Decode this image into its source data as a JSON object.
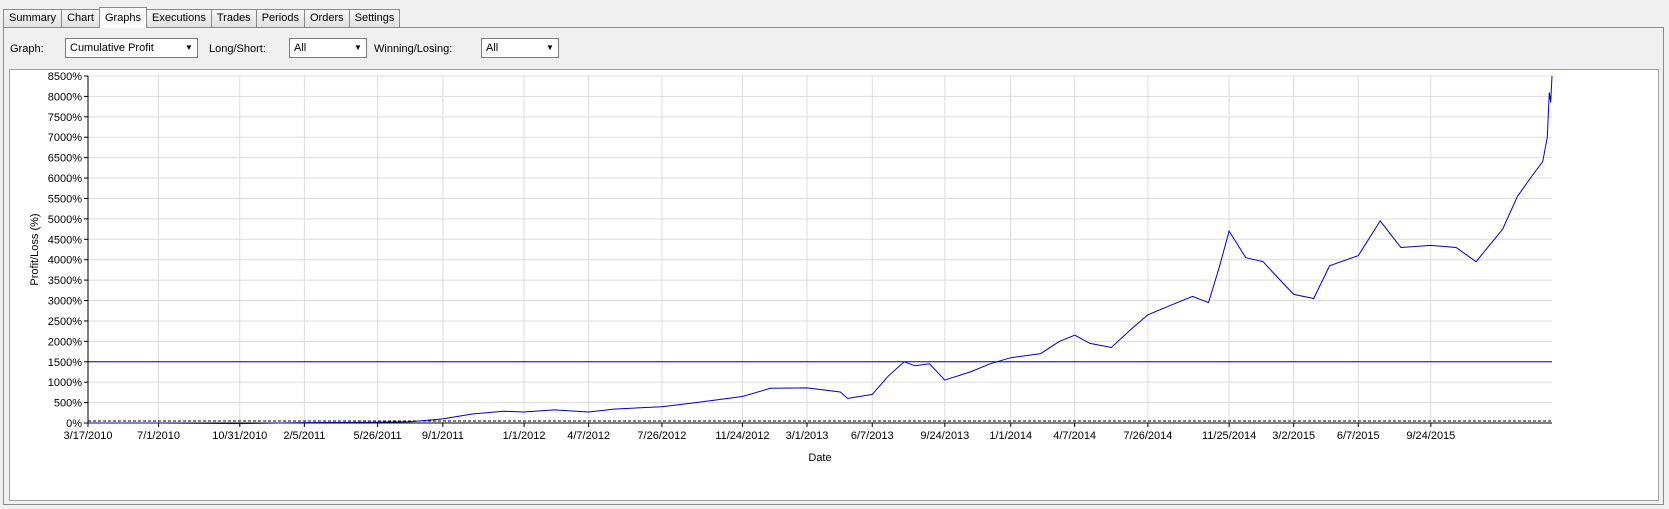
{
  "tabs": [
    {
      "label": "Summary",
      "active": false
    },
    {
      "label": "Chart",
      "active": false
    },
    {
      "label": "Graphs",
      "active": true
    },
    {
      "label": "Executions",
      "active": false
    },
    {
      "label": "Trades",
      "active": false
    },
    {
      "label": "Periods",
      "active": false
    },
    {
      "label": "Orders",
      "active": false
    },
    {
      "label": "Settings",
      "active": false
    }
  ],
  "filters": {
    "graph": {
      "label": "Graph:",
      "value": "Cumulative Profit"
    },
    "long_short": {
      "label": "Long/Short:",
      "value": "All"
    },
    "winning_losing": {
      "label": "Winning/Losing:",
      "value": "All"
    }
  },
  "colors": {
    "line": "#0000cc",
    "grid": "#dcdcdc",
    "text": "#000000"
  },
  "chart_data": {
    "type": "line",
    "xlabel": "Date",
    "ylabel": "Profit/Loss (%)",
    "ylim": [
      0,
      8500
    ],
    "yticks": [
      "0%",
      "500%",
      "1000%",
      "1500%",
      "2000%",
      "2500%",
      "3000%",
      "3500%",
      "4000%",
      "4500%",
      "5000%",
      "5500%",
      "6000%",
      "6500%",
      "7000%",
      "7500%",
      "8000%",
      "8500%"
    ],
    "xticks": [
      "3/17/2010",
      "7/1/2010",
      "10/31/2010",
      "2/5/2011",
      "5/26/2011",
      "9/1/2011",
      "1/1/2012",
      "4/7/2012",
      "7/26/2012",
      "11/24/2012",
      "3/1/2013",
      "6/7/2013",
      "9/24/2013",
      "1/1/2014",
      "4/7/2014",
      "7/26/2014",
      "11/25/2014",
      "3/2/2015",
      "6/7/2015",
      "9/24/2015"
    ],
    "x_range": [
      "3/17/2010",
      "3/24/2016"
    ],
    "reference_line": 1500,
    "grid": true,
    "series": [
      {
        "points": [
          [
            "3/17/2010",
            0
          ],
          [
            "7/1/2010",
            0
          ],
          [
            "10/31/2010",
            -15
          ],
          [
            "2/5/2011",
            10
          ],
          [
            "5/26/2011",
            20
          ],
          [
            "7/15/2011",
            30
          ],
          [
            "9/1/2011",
            100
          ],
          [
            "10/15/2011",
            220
          ],
          [
            "12/1/2011",
            290
          ],
          [
            "1/1/2012",
            270
          ],
          [
            "2/15/2012",
            320
          ],
          [
            "4/7/2012",
            270
          ],
          [
            "5/15/2012",
            340
          ],
          [
            "7/26/2012",
            400
          ],
          [
            "9/15/2012",
            500
          ],
          [
            "11/24/2012",
            650
          ],
          [
            "1/5/2013",
            850
          ],
          [
            "3/1/2013",
            860
          ],
          [
            "4/20/2013",
            760
          ],
          [
            "5/1/2013",
            600
          ],
          [
            "6/7/2013",
            700
          ],
          [
            "7/1/2013",
            1150
          ],
          [
            "7/25/2013",
            1500
          ],
          [
            "8/10/2013",
            1400
          ],
          [
            "9/1/2013",
            1450
          ],
          [
            "9/24/2013",
            1050
          ],
          [
            "11/1/2013",
            1250
          ],
          [
            "12/1/2013",
            1450
          ],
          [
            "1/1/2014",
            1600
          ],
          [
            "2/15/2014",
            1700
          ],
          [
            "3/15/2014",
            2000
          ],
          [
            "4/7/2014",
            2150
          ],
          [
            "4/30/2014",
            1950
          ],
          [
            "6/1/2014",
            1850
          ],
          [
            "7/1/2014",
            2300
          ],
          [
            "7/26/2014",
            2650
          ],
          [
            "9/1/2014",
            2900
          ],
          [
            "10/1/2014",
            3100
          ],
          [
            "10/25/2014",
            2950
          ],
          [
            "11/10/2014",
            3800
          ],
          [
            "11/25/2014",
            4700
          ],
          [
            "12/20/2014",
            4050
          ],
          [
            "1/15/2015",
            3950
          ],
          [
            "2/1/2015",
            3650
          ],
          [
            "3/2/2015",
            3150
          ],
          [
            "4/1/2015",
            3050
          ],
          [
            "4/25/2015",
            3850
          ],
          [
            "6/7/2015",
            4100
          ],
          [
            "7/10/2015",
            4950
          ],
          [
            "8/10/2015",
            4300
          ],
          [
            "9/24/2015",
            4350
          ],
          [
            "11/1/2015",
            4300
          ],
          [
            "12/1/2015",
            3950
          ],
          [
            "1/10/2016",
            4750
          ],
          [
            "2/1/2016",
            5550
          ],
          [
            "2/25/2016",
            6100
          ],
          [
            "3/10/2016",
            6400
          ],
          [
            "3/17/2016",
            7000
          ],
          [
            "3/20/2016",
            8100
          ],
          [
            "3/22/2016",
            7850
          ],
          [
            "3/24/2016",
            8500
          ]
        ]
      }
    ]
  }
}
